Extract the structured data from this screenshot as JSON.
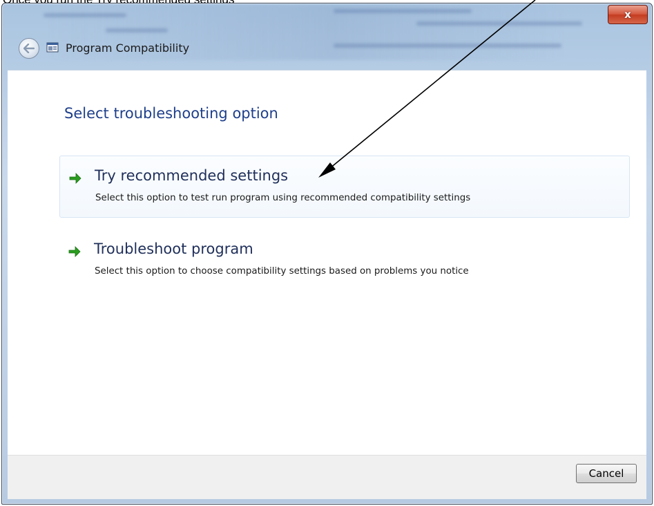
{
  "caption": {
    "text": "Once you run the Try recommended settings"
  },
  "window": {
    "title": "Program Compatibility",
    "close_label": "x"
  },
  "content": {
    "heading": "Select troubleshooting option",
    "options": [
      {
        "title": "Try recommended settings",
        "description": "Select this option to test run program using recommended compatibility settings"
      },
      {
        "title": "Troubleshoot program",
        "description": "Select this option to choose compatibility settings based on problems you notice"
      }
    ]
  },
  "footer": {
    "cancel_label": "Cancel"
  },
  "colors": {
    "heading": "#1e3f8a",
    "arrow_green": "#2a9d1f",
    "close_red": "#c33d22"
  },
  "icons": {
    "back": "back-arrow-icon",
    "app": "program-compatibility-icon",
    "option_arrow": "green-arrow-icon"
  }
}
